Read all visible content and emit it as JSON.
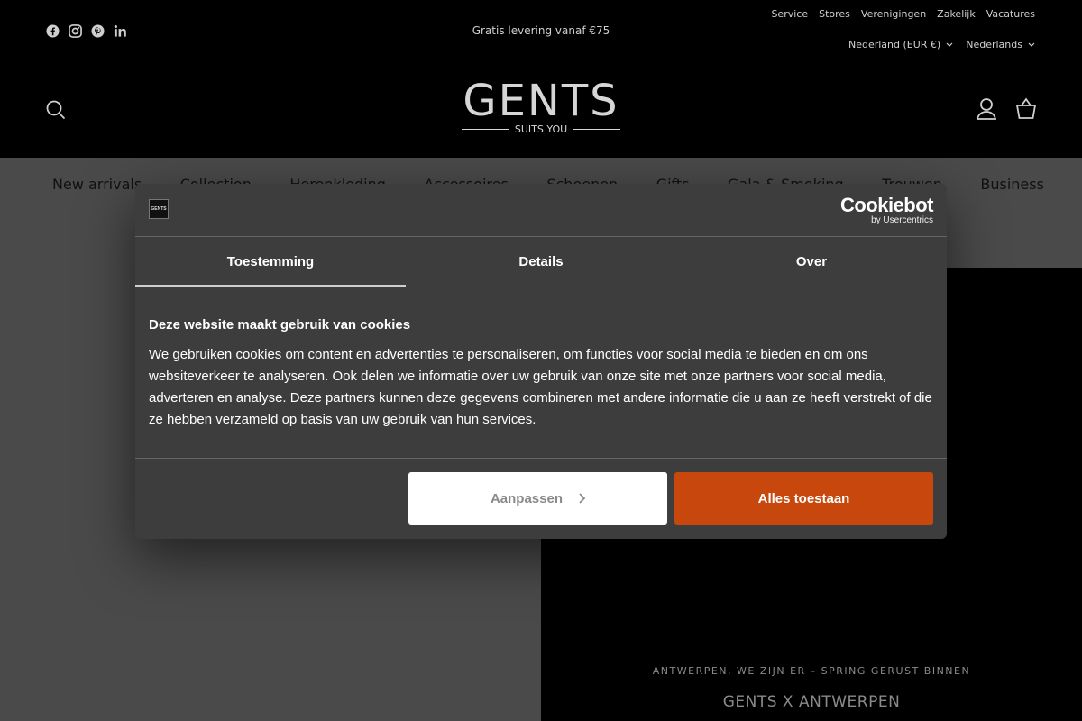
{
  "header": {
    "social": [
      "facebook-icon",
      "instagram-icon",
      "pinterest-icon",
      "linkedin-icon"
    ],
    "promo": "Gratis levering vanaf €75",
    "top_links": [
      "Service",
      "Stores",
      "Verenigingen",
      "Zakelijk",
      "Vacatures"
    ],
    "country_selector": "Nederland (EUR €)",
    "language_selector": "Nederlands",
    "logo_text": "GENTS",
    "logo_tagline": "SUITS YOU"
  },
  "nav": {
    "items": [
      "New arrivals",
      "Collection",
      "Herenkleding",
      "Accessoires",
      "Schoenen",
      "Gifts",
      "Gala & Smoking",
      "Trouwen",
      "Business"
    ]
  },
  "hero": {
    "kicker": "ANTWERPEN, WE ZIJN ER – SPRING GERUST BINNEN",
    "title": "GENTS X ANTWERPEN"
  },
  "cookie_dialog": {
    "logo_text": "GENTS",
    "brand": "Cookiebot",
    "brand_sub": "by Usercentrics",
    "tabs": [
      "Toestemming",
      "Details",
      "Over"
    ],
    "active_tab": "Toestemming",
    "heading": "Deze website maakt gebruik van cookies",
    "body": "We gebruiken cookies om content en advertenties te personaliseren, om functies voor social media te bieden en om ons websiteverkeer te analyseren. Ook delen we informatie over uw gebruik van onze site met onze partners voor social media, adverteren en analyse. Deze partners kunnen deze gegevens combineren met andere informatie die u aan ze heeft verstrekt of die ze hebben verzameld op basis van uw gebruik van hun services.",
    "customize_label": "Aanpassen",
    "allow_all_label": "Alles toestaan",
    "accent_color": "#c7470d"
  }
}
